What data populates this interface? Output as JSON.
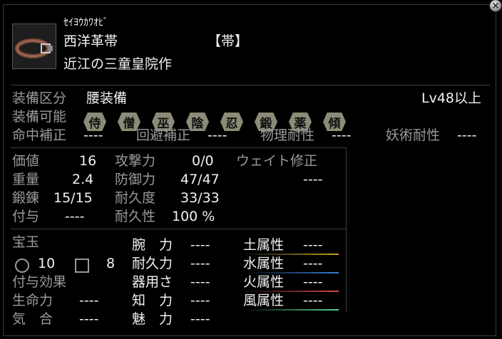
{
  "item": {
    "reading": "ｾｲﾖｳｶﾜｵﾋﾞ",
    "name": "西洋革帯",
    "type_tag": "【帯】",
    "maker": "近江の三童皇院作"
  },
  "equip": {
    "slot_label": "装備区分",
    "slot_value": "腰装備",
    "level_req": "Lv48以上",
    "classes_label": "装備可能",
    "classes": [
      "侍",
      "僧",
      "巫",
      "陰",
      "忍",
      "鍛",
      "薬",
      "傾"
    ]
  },
  "modifiers": {
    "hit_label": "命中補正",
    "hit_value": "----",
    "evade_label": "回避補正",
    "evade_value": "----",
    "phys_label": "物理耐性",
    "phys_value": "----",
    "magic_label": "妖術耐性",
    "magic_value": "----"
  },
  "stats": {
    "value_label": "価値",
    "value": "16",
    "weight_label": "重量",
    "weight": "2.4",
    "forge_label": "鍛錬",
    "forge": "15/15",
    "enchant_label": "付与",
    "enchant": "----",
    "attack_label": "攻撃力",
    "attack": "0/0",
    "defense_label": "防御力",
    "defense": "47/47",
    "durability_label": "耐久度",
    "durability": "33/33",
    "durability_pct_label": "耐久性",
    "durability_pct": "100 %",
    "weight_mod_label": "ウェイト修正",
    "weight_mod": "----"
  },
  "gems": {
    "label": "宝玉",
    "circle_count": "10",
    "square_count": "8"
  },
  "enchant_effects_label": "付与効果",
  "attributes": {
    "life_label": "生命力",
    "life": "----",
    "spirit_label": "気　合",
    "spirit": "----",
    "str_label": "腕　力",
    "str": "----",
    "stamina_label": "耐久力",
    "stamina": "----",
    "dex_label": "器用さ",
    "dex": "----",
    "int_label": "知　力",
    "int": "----",
    "charm_label": "魅　力",
    "charm": "----"
  },
  "elements": [
    {
      "label": "土属性",
      "value": "----",
      "color": "#c8a030"
    },
    {
      "label": "水属性",
      "value": "----",
      "color": "#3a7ad8"
    },
    {
      "label": "火属性",
      "value": "----",
      "color": "#d84a4a"
    },
    {
      "label": "風属性",
      "value": "----",
      "color": "#5ad88a"
    }
  ],
  "colors": {
    "label_gray": "#9a9a9a",
    "badge": "#8b8b78"
  }
}
